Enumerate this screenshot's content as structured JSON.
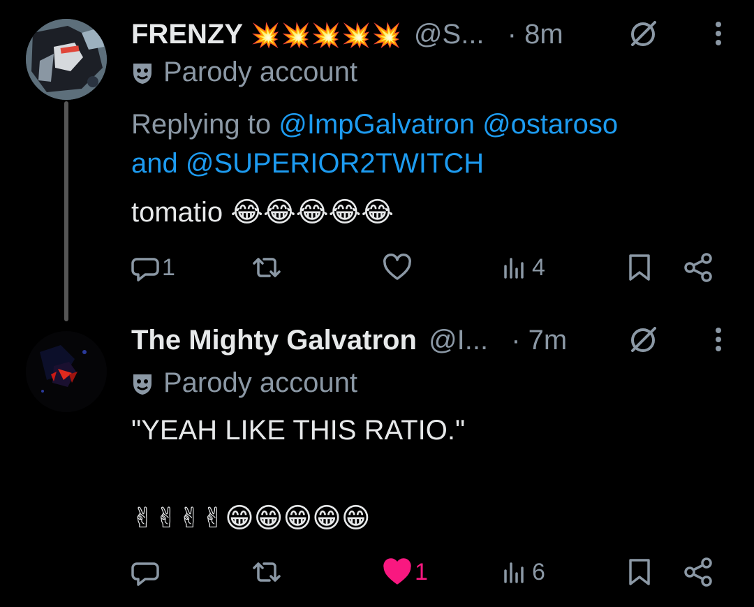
{
  "tweets": [
    {
      "display_name": "FRENZY",
      "name_decoration": "💥💥💥💥💥",
      "handle": "@S...",
      "time": "· 8m",
      "parody_label": "Parody account",
      "replying_prefix": "Replying to",
      "replying_handles": [
        "@ImpGalvatron",
        "@ostaroso"
      ],
      "replying_and": "and",
      "replying_last": "@SUPERIOR2TWITCH",
      "text": "tomatio",
      "text_emoji": "😂😂😂😂😂",
      "reply_count": "1",
      "retweet_count": "",
      "like_count": "",
      "view_count": "4"
    },
    {
      "display_name": "The Mighty Galvatron",
      "handle": "@I...",
      "time": "· 7m",
      "parody_label": "Parody account",
      "text_line1": "\"YEAH LIKE THIS RATIO.\"",
      "text_emoji": "✌✌✌✌😁😁😁😁😁",
      "reply_count": "",
      "retweet_count": "",
      "like_count": "1",
      "view_count": "6"
    }
  ],
  "colors": {
    "background": "#000000",
    "text": "#e7e9ea",
    "muted": "#8b98a5",
    "link": "#1d9bf0",
    "like_active": "#f91880",
    "thread_line": "#555555"
  },
  "icons": [
    "reply-icon",
    "retweet-icon",
    "like-icon",
    "views-icon",
    "bookmark-icon",
    "share-icon",
    "more-icon",
    "no-reply-icon",
    "parody-mask-icon"
  ]
}
